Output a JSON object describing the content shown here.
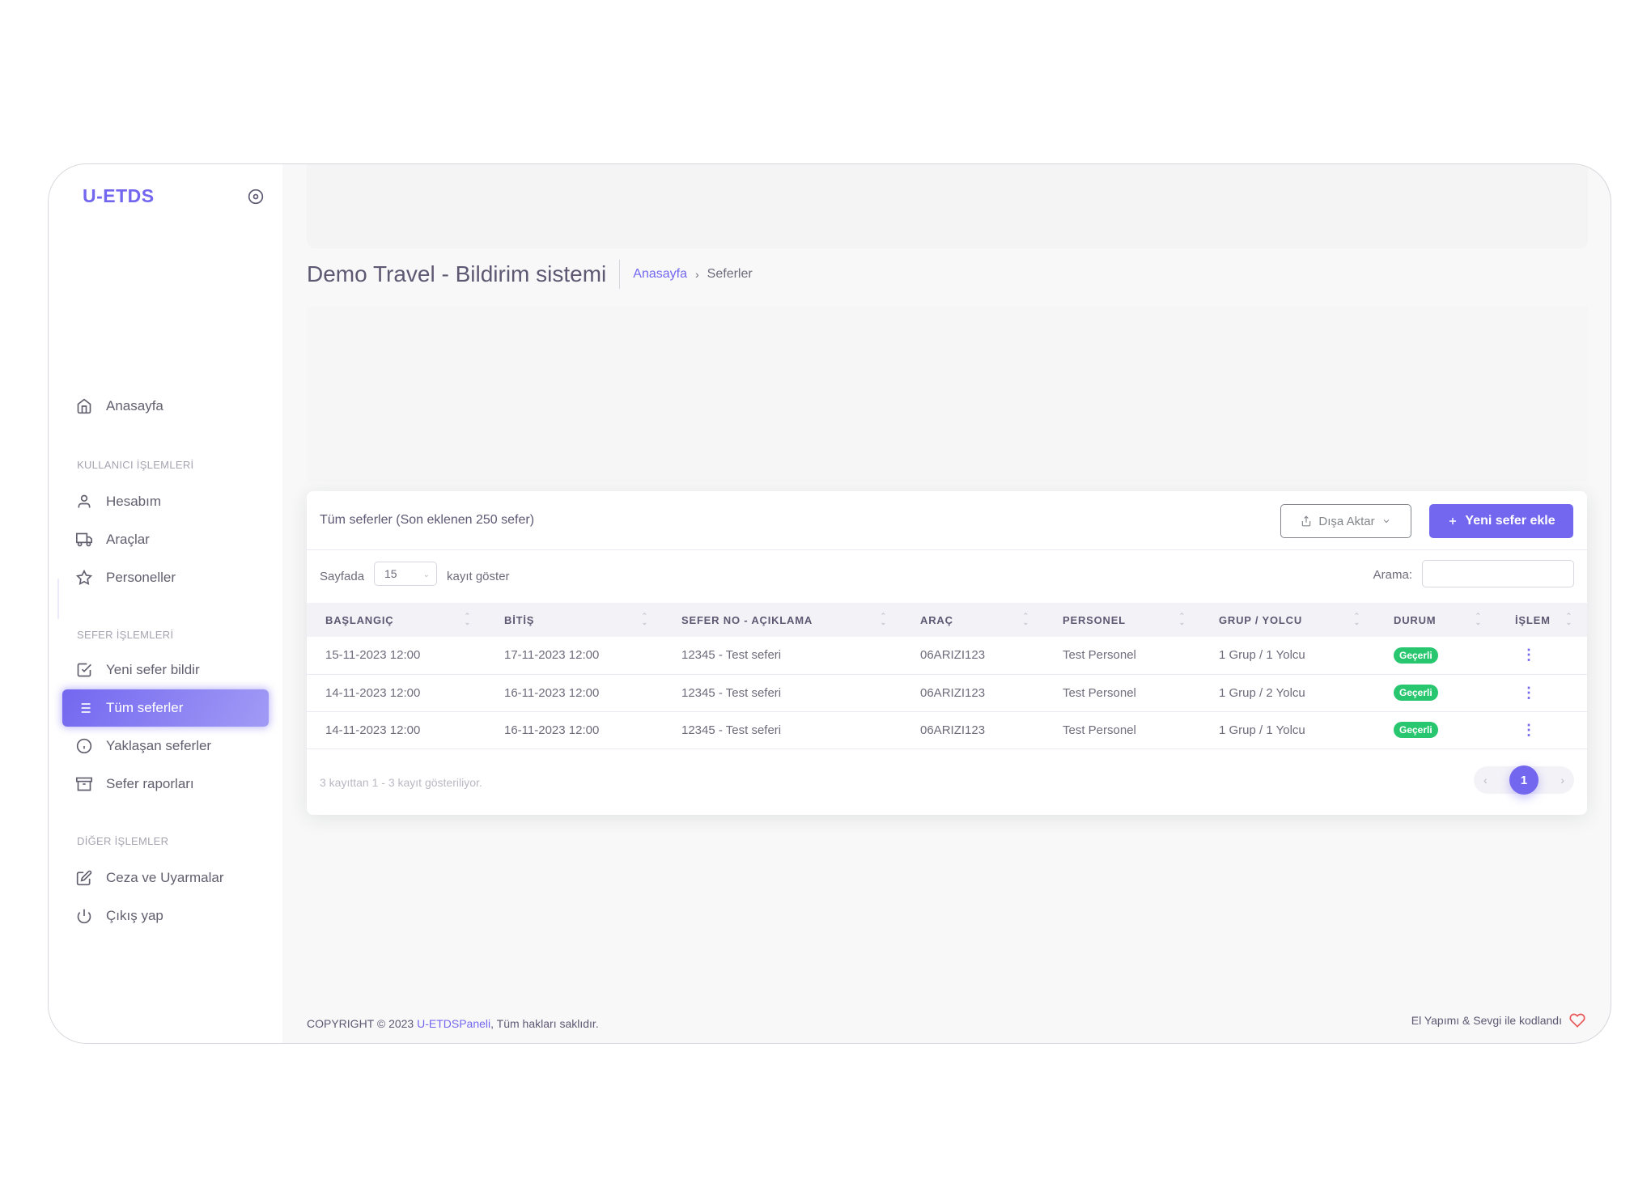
{
  "brand": "U-ETDS",
  "sidebar": {
    "home": "Anasayfa",
    "section_user": "KULLANICI İŞLEMLERİ",
    "account": "Hesabım",
    "vehicles": "Araçlar",
    "staff": "Personeller",
    "section_trip": "SEFER İŞLEMLERİ",
    "new_trip": "Yeni sefer bildir",
    "all_trips": "Tüm seferler",
    "upcoming": "Yaklaşan seferler",
    "reports": "Sefer raporları",
    "section_other": "DİĞER İŞLEMLER",
    "penalties": "Ceza ve Uyarmalar",
    "logout": "Çıkış yap"
  },
  "header": {
    "title": "Demo Travel - Bildirim sistemi",
    "breadcrumb_home": "Anasayfa",
    "breadcrumb_sep": "›",
    "breadcrumb_current": "Seferler"
  },
  "card": {
    "title": "Tüm seferler (Son eklenen 250 sefer)",
    "export_label": "Dışa Aktar",
    "add_label": "Yeni sefer ekle",
    "per_page_label": "Sayfada",
    "per_page_value": "15",
    "per_page_suffix": "kayıt göster",
    "search_label": "Arama:",
    "search_value": ""
  },
  "table": {
    "headers": [
      "BAŞLANGIÇ",
      "BİTİŞ",
      "SEFER NO - AÇIKLAMA",
      "ARAÇ",
      "PERSONEL",
      "GRUP / YOLCU",
      "DURUM",
      "İŞLEM"
    ],
    "rows": [
      {
        "start": "15-11-2023 12:00",
        "end": "17-11-2023 12:00",
        "trip": "12345 - Test seferi",
        "vehicle": "06ARIZI123",
        "staff": "Test Personel",
        "group": "1 Grup / 1 Yolcu",
        "status": "Geçerli"
      },
      {
        "start": "14-11-2023 12:00",
        "end": "16-11-2023 12:00",
        "trip": "12345 - Test seferi",
        "vehicle": "06ARIZI123",
        "staff": "Test Personel",
        "group": "1 Grup / 2 Yolcu",
        "status": "Geçerli"
      },
      {
        "start": "14-11-2023 12:00",
        "end": "16-11-2023 12:00",
        "trip": "12345 - Test seferi",
        "vehicle": "06ARIZI123",
        "staff": "Test Personel",
        "group": "1 Grup / 1 Yolcu",
        "status": "Geçerli"
      }
    ]
  },
  "pagination": {
    "info": "3 kayıttan 1 - 3 kayıt gösteriliyor.",
    "current_page": "1",
    "prev": "‹",
    "next": "›"
  },
  "footer": {
    "copyright_prefix": "COPYRIGHT © 2023 ",
    "copyright_link": "U-ETDSPaneli",
    "copyright_suffix": ", Tüm hakları saklıdır.",
    "made_with": "El Yapımı & Sevgi ile kodlandı"
  },
  "colors": {
    "primary": "#7367f0",
    "success": "#28c76f",
    "heart": "#ea5455"
  }
}
